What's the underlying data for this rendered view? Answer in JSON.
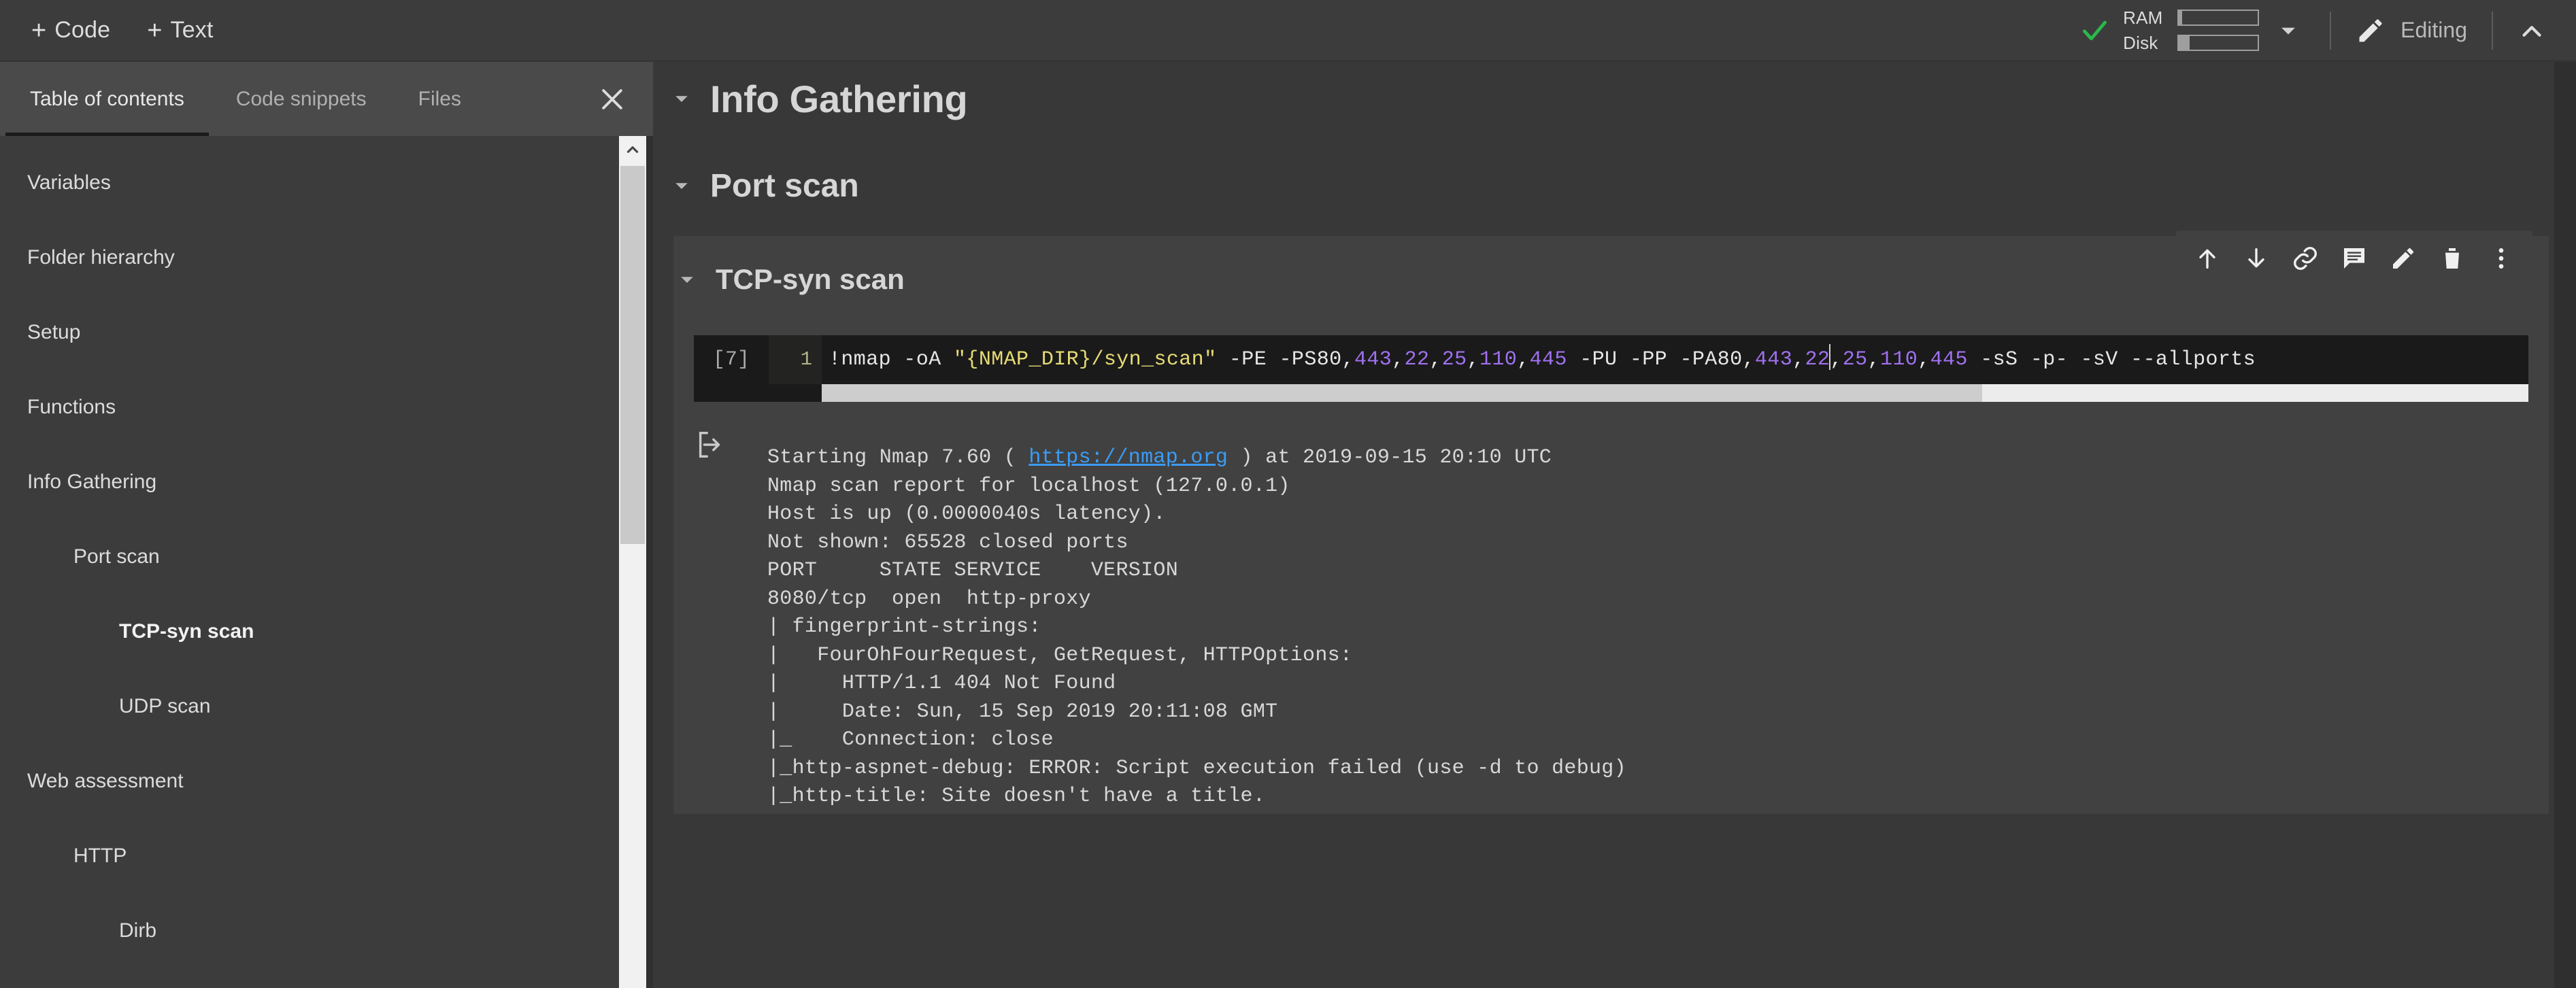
{
  "topbar": {
    "add_code_label": "Code",
    "add_text_label": "Text",
    "plus_glyph": "+",
    "ram_label": "RAM",
    "disk_label": "Disk",
    "ram_fill_percent": 4,
    "disk_fill_percent": 14,
    "connected_icon": "green-check-icon",
    "resource_caret_icon": "caret-down-icon",
    "editing_label": "Editing",
    "editing_icon": "pencil-icon",
    "collapse_icon": "chevron-up-icon",
    "accent_check_color": "#2bb84b"
  },
  "sidebar": {
    "tabs": [
      {
        "label": "Table of contents",
        "active": true
      },
      {
        "label": "Code snippets",
        "active": false
      },
      {
        "label": "Files",
        "active": false
      }
    ],
    "close_icon": "close-icon",
    "scroll_up_icon": "chevron-up-icon",
    "toc": [
      {
        "label": "Variables",
        "level": 1,
        "active": false
      },
      {
        "label": "Folder hierarchy",
        "level": 1,
        "active": false
      },
      {
        "label": "Setup",
        "level": 1,
        "active": false
      },
      {
        "label": "Functions",
        "level": 1,
        "active": false
      },
      {
        "label": "Info Gathering",
        "level": 1,
        "active": false
      },
      {
        "label": "Port scan",
        "level": 2,
        "active": false
      },
      {
        "label": "TCP-syn scan",
        "level": 3,
        "active": true
      },
      {
        "label": "UDP scan",
        "level": 3,
        "active": false
      },
      {
        "label": "Web assessment",
        "level": 1,
        "active": false
      },
      {
        "label": "HTTP",
        "level": 2,
        "active": false
      },
      {
        "label": "Dirb",
        "level": 3,
        "active": false
      }
    ]
  },
  "main": {
    "headings": [
      {
        "text": "Info Gathering",
        "level": 1,
        "caret": "caret-down-icon"
      },
      {
        "text": "Port scan",
        "level": 2,
        "caret": "caret-down-icon"
      },
      {
        "text": "TCP-syn scan",
        "level": 3,
        "caret": "caret-down-icon"
      }
    ],
    "cell_toolbar": [
      {
        "name": "move-cell-up-button",
        "icon": "arrow-up-icon"
      },
      {
        "name": "move-cell-down-button",
        "icon": "arrow-down-icon"
      },
      {
        "name": "link-to-cell-button",
        "icon": "link-icon"
      },
      {
        "name": "add-comment-button",
        "icon": "comment-icon"
      },
      {
        "name": "edit-cell-button",
        "icon": "pencil-icon"
      },
      {
        "name": "delete-cell-button",
        "icon": "trash-icon"
      },
      {
        "name": "more-options-button",
        "icon": "more-vertical-icon"
      }
    ],
    "code_cell": {
      "execution_count": "[7]",
      "line_number": "1",
      "tokens": [
        {
          "t": "!nmap -oA ",
          "c": "plain"
        },
        {
          "t": "\"{NMAP_DIR}/syn_scan\"",
          "c": "string"
        },
        {
          "t": " -PE -PS80",
          "c": "plain"
        },
        {
          "t": ",",
          "c": "punct"
        },
        {
          "t": "443",
          "c": "number"
        },
        {
          "t": ",",
          "c": "punct"
        },
        {
          "t": "22",
          "c": "number"
        },
        {
          "t": ",",
          "c": "punct"
        },
        {
          "t": "25",
          "c": "number"
        },
        {
          "t": ",",
          "c": "punct"
        },
        {
          "t": "110",
          "c": "number"
        },
        {
          "t": ",",
          "c": "punct"
        },
        {
          "t": "445",
          "c": "number"
        },
        {
          "t": " -PU -PP -PA80",
          "c": "plain"
        },
        {
          "t": ",",
          "c": "punct"
        },
        {
          "t": "443",
          "c": "number"
        },
        {
          "t": ",",
          "c": "punct"
        },
        {
          "t": "22",
          "c": "number"
        },
        {
          "t": "CARET",
          "c": "caret"
        },
        {
          "t": ",",
          "c": "punct"
        },
        {
          "t": "25",
          "c": "number"
        },
        {
          "t": ",",
          "c": "punct"
        },
        {
          "t": "110",
          "c": "number"
        },
        {
          "t": ",",
          "c": "punct"
        },
        {
          "t": "445",
          "c": "number"
        },
        {
          "t": " -sS -p- -sV --allports ",
          "c": "plain"
        }
      ],
      "full_text": "!nmap -oA \"{NMAP_DIR}/syn_scan\" -PE -PS80,443,22,25,110,445 -PU -PP -PA80,443,22,25,110,445 -sS -p- -sV --allports",
      "hscroll_thumb_percent": 68
    },
    "output": {
      "icon": "output-arrow-icon",
      "link_text": "https://nmap.org",
      "line_prefix": "Starting Nmap 7.60 ( ",
      "line_suffix": " ) at 2019-09-15 20:10 UTC",
      "lines": [
        "Nmap scan report for localhost (127.0.0.1)",
        "Host is up (0.0000040s latency).",
        "Not shown: 65528 closed ports",
        "PORT     STATE SERVICE    VERSION",
        "8080/tcp  open  http-proxy",
        "| fingerprint-strings: ",
        "|   FourOhFourRequest, GetRequest, HTTPOptions: ",
        "|     HTTP/1.1 404 Not Found",
        "|     Date: Sun, 15 Sep 2019 20:11:08 GMT",
        "|_    Connection: close",
        "|_http-aspnet-debug: ERROR: Script execution failed (use -d to debug)",
        "|_http-title: Site doesn't have a title."
      ]
    }
  }
}
